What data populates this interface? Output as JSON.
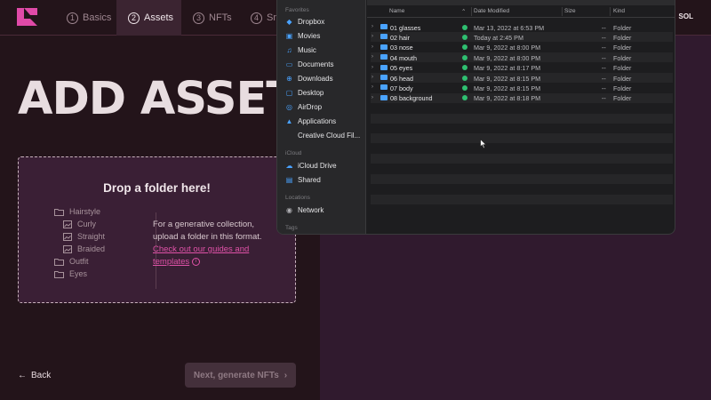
{
  "steps": [
    {
      "num": "1",
      "label": "Basics"
    },
    {
      "num": "2",
      "label": "Assets"
    },
    {
      "num": "3",
      "label": "NFTs"
    },
    {
      "num": "4",
      "label": "Sm"
    }
  ],
  "currency": "SOL",
  "page_title": "ADD ASSETS",
  "dropzone": {
    "title": "Drop a folder here!",
    "tree": [
      "Hairstyle",
      "Curly",
      "Straight",
      "Braided",
      "Outfit",
      "Eyes"
    ],
    "info_text": "For a generative collection, upload a folder in this format.",
    "link_text": "Check out our guides and templates"
  },
  "footer": {
    "back_label": "Back",
    "next_label": "Next, generate NFTs"
  },
  "finder": {
    "sidebar": {
      "favorites_label": "Favorites",
      "favorites": [
        {
          "label": "Dropbox",
          "icon": "dropbox-icon"
        },
        {
          "label": "Movies",
          "icon": "movies-icon"
        },
        {
          "label": "Music",
          "icon": "music-icon"
        },
        {
          "label": "Documents",
          "icon": "documents-icon"
        },
        {
          "label": "Downloads",
          "icon": "downloads-icon"
        },
        {
          "label": "Desktop",
          "icon": "desktop-icon"
        },
        {
          "label": "AirDrop",
          "icon": "airdrop-icon"
        },
        {
          "label": "Applications",
          "icon": "applications-icon"
        },
        {
          "label": "Creative Cloud Fil...",
          "icon": "creative-cloud-icon"
        }
      ],
      "icloud_label": "iCloud",
      "icloud": [
        {
          "label": "iCloud Drive",
          "icon": "icloud-drive-icon"
        },
        {
          "label": "Shared",
          "icon": "shared-icon"
        }
      ],
      "locations_label": "Locations",
      "locations": [
        {
          "label": "Network",
          "icon": "network-icon"
        }
      ],
      "tags_label": "Tags"
    },
    "columns": {
      "name": "Name",
      "date": "Date Modified",
      "size": "Size",
      "kind": "Kind"
    },
    "rows": [
      {
        "name": "01 glasses",
        "date": "Mar 13, 2022 at 6:53 PM",
        "size": "--",
        "kind": "Folder"
      },
      {
        "name": "02 hair",
        "date": "Today at 2:45 PM",
        "size": "--",
        "kind": "Folder"
      },
      {
        "name": "03 nose",
        "date": "Mar 9, 2022 at 8:00 PM",
        "size": "--",
        "kind": "Folder"
      },
      {
        "name": "04 mouth",
        "date": "Mar 9, 2022 at 8:00 PM",
        "size": "--",
        "kind": "Folder"
      },
      {
        "name": "05 eyes",
        "date": "Mar 9, 2022 at 8:17 PM",
        "size": "--",
        "kind": "Folder"
      },
      {
        "name": "06 head",
        "date": "Mar 9, 2022 at 8:15 PM",
        "size": "--",
        "kind": "Folder"
      },
      {
        "name": "07 body",
        "date": "Mar 9, 2022 at 8:15 PM",
        "size": "--",
        "kind": "Folder"
      },
      {
        "name": "08 background",
        "date": "Mar 9, 2022 at 8:18 PM",
        "size": "--",
        "kind": "Folder"
      }
    ]
  },
  "colors": {
    "accent_link": "#e052a8",
    "background": "#23141a",
    "panel": "#301a2e"
  }
}
